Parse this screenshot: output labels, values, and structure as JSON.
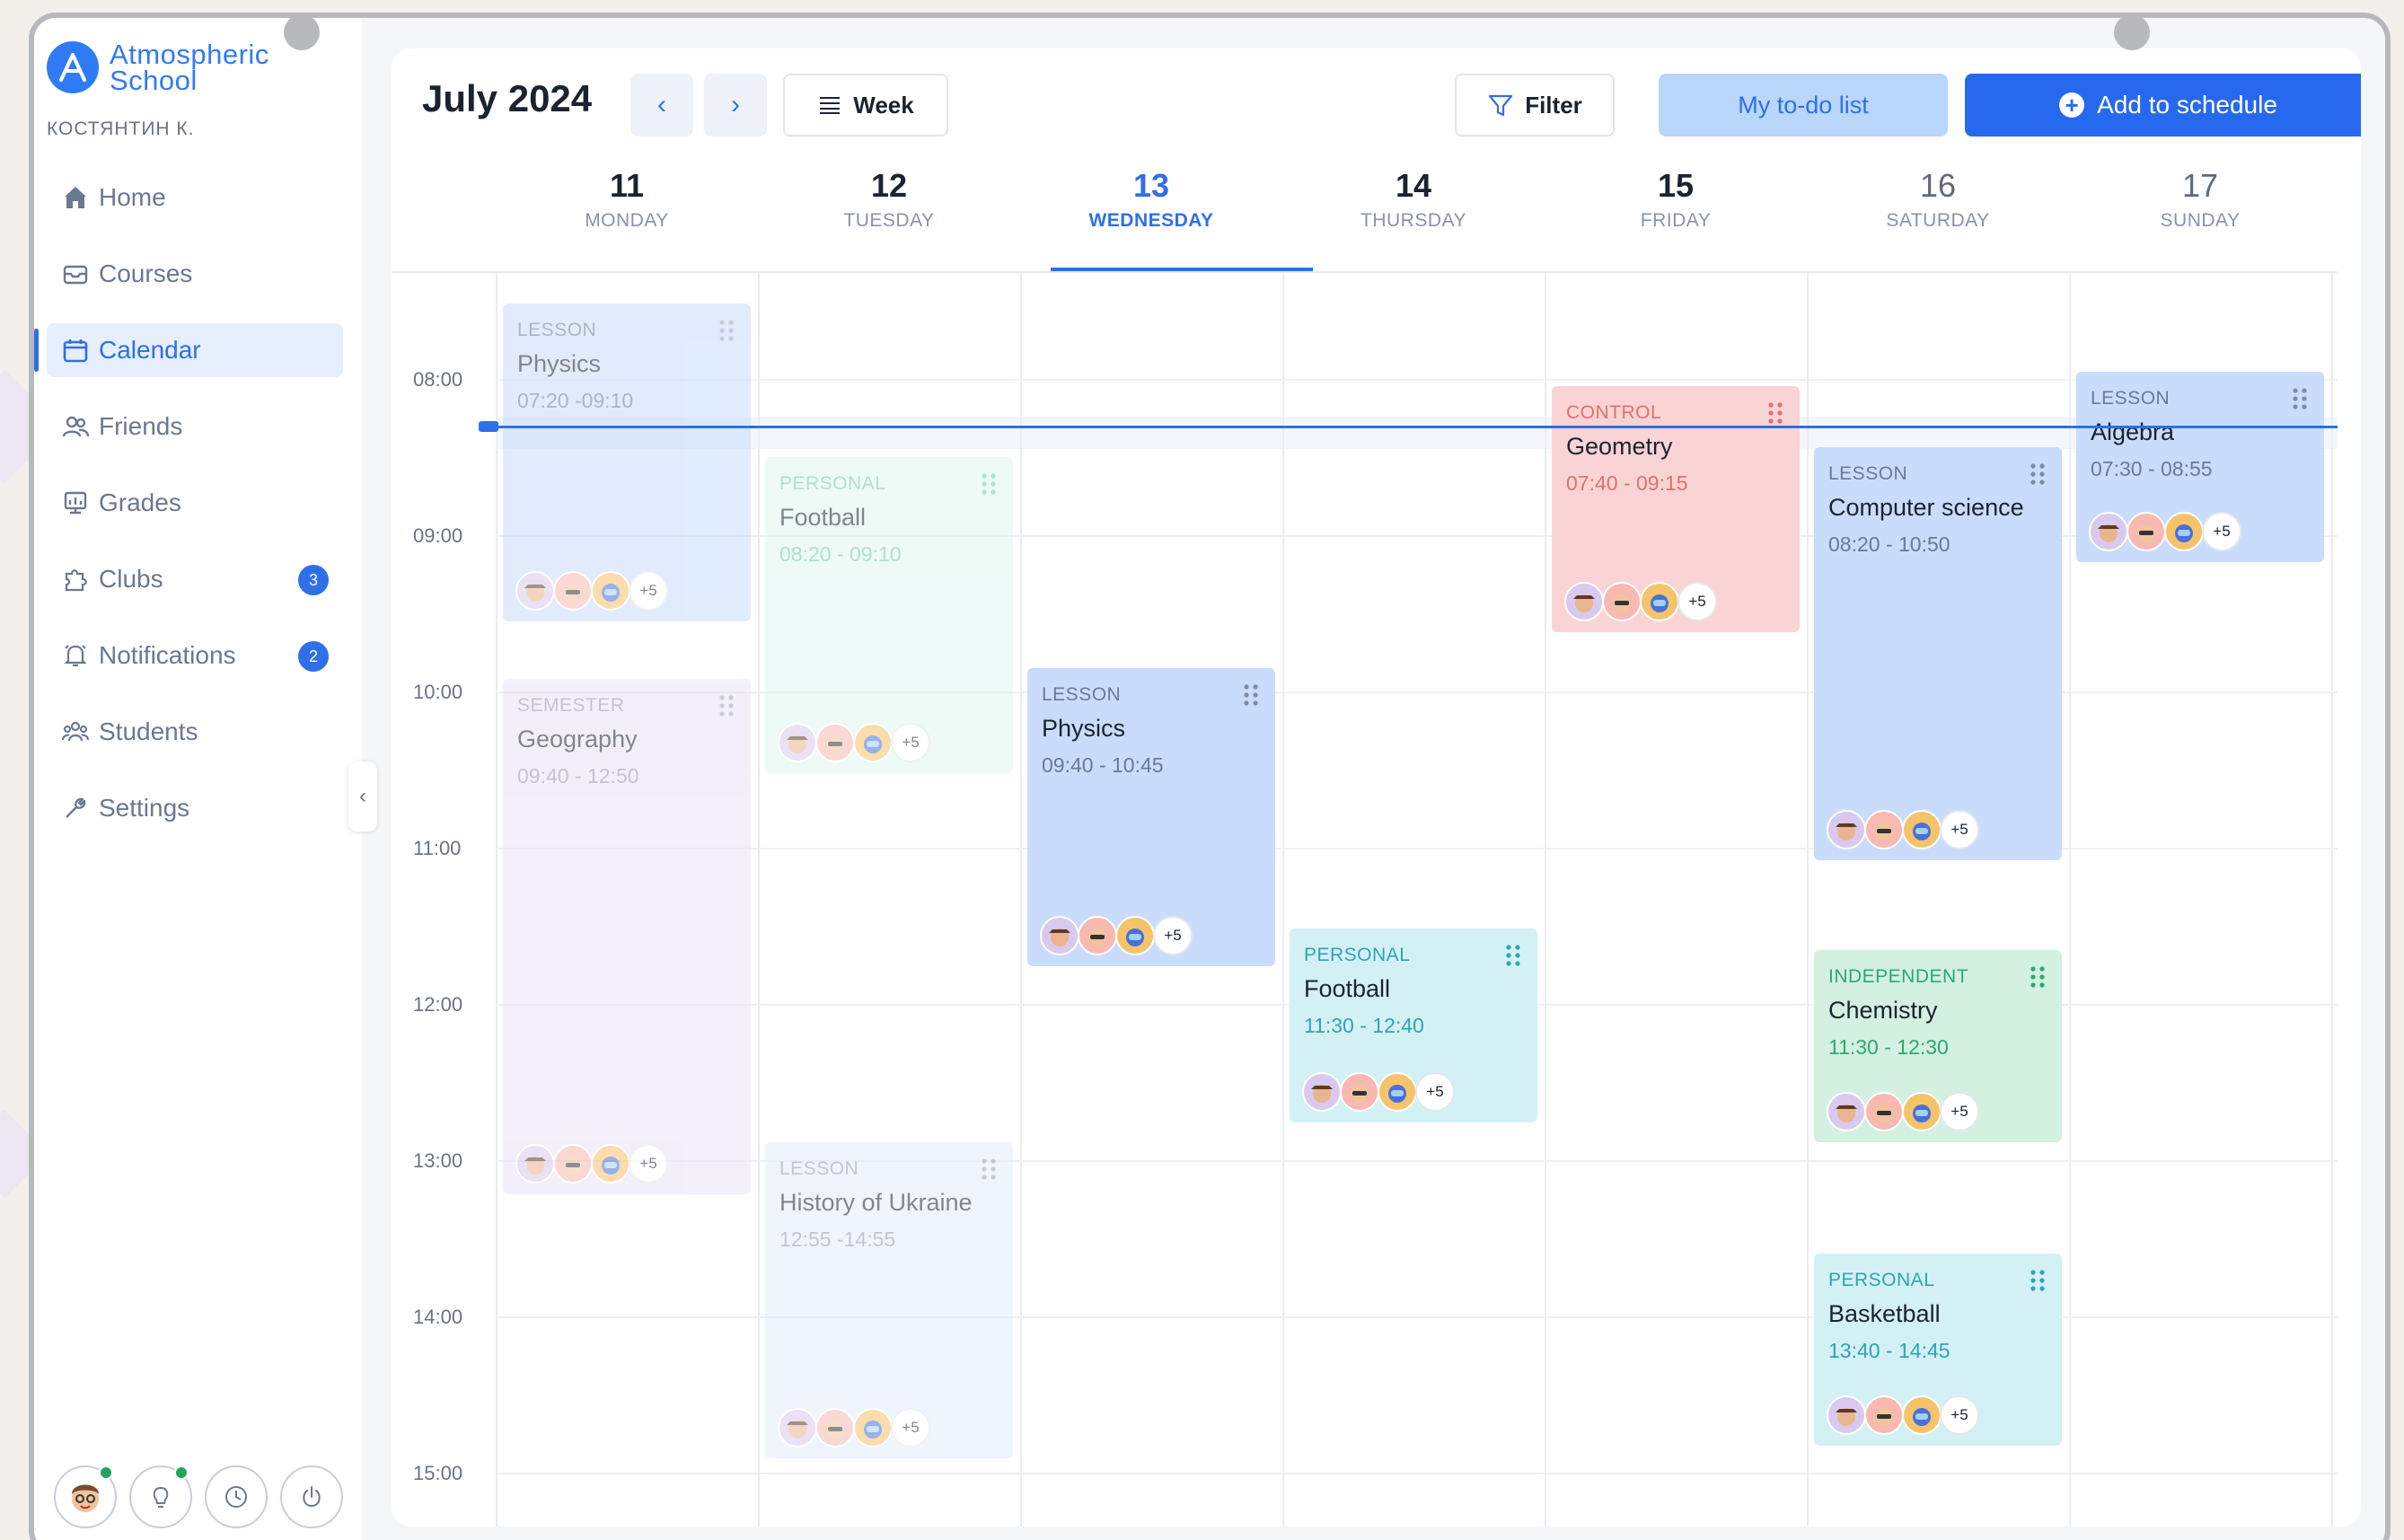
{
  "brand": {
    "line1": "Atmospheric",
    "line2": "School"
  },
  "user": {
    "name": "КОСТЯНТИН К."
  },
  "nav": [
    {
      "id": "home",
      "label": "Home",
      "icon": "home-icon"
    },
    {
      "id": "courses",
      "label": "Courses",
      "icon": "inbox-icon"
    },
    {
      "id": "calendar",
      "label": "Calendar",
      "icon": "calendar-icon",
      "active": true
    },
    {
      "id": "friends",
      "label": "Friends",
      "icon": "friends-icon"
    },
    {
      "id": "grades",
      "label": "Grades",
      "icon": "grades-icon"
    },
    {
      "id": "clubs",
      "label": "Clubs",
      "icon": "puzzle-icon",
      "badge": "3"
    },
    {
      "id": "notifications",
      "label": "Notifications",
      "icon": "bell-icon",
      "badge": "2"
    },
    {
      "id": "students",
      "label": "Students",
      "icon": "students-icon"
    },
    {
      "id": "settings",
      "label": "Settings",
      "icon": "wrench-icon"
    }
  ],
  "toolbar": {
    "month": "July 2024",
    "view": "Week",
    "filter": "Filter",
    "todo": "My to-do list",
    "add": "Add to schedule"
  },
  "days": [
    {
      "num": "11",
      "name": "MONDAY"
    },
    {
      "num": "12",
      "name": "TUESDAY"
    },
    {
      "num": "13",
      "name": "WEDNESDAY",
      "today": true
    },
    {
      "num": "14",
      "name": "THURSDAY"
    },
    {
      "num": "15",
      "name": "FRIDAY"
    },
    {
      "num": "16",
      "name": "SATURDAY"
    },
    {
      "num": "17",
      "name": "SUNDAY"
    }
  ],
  "times": [
    "08:00",
    "09:00",
    "10:00",
    "11:00",
    "12:00",
    "13:00",
    "14:00",
    "15:00"
  ],
  "events": [
    {
      "type": "LESSON",
      "title": "Physics",
      "time": "07:20 -09:10",
      "more": "+5",
      "color": "#c9dcfb"
    },
    {
      "type": "SEMESTER",
      "title": "Geography",
      "time": "09:40 - 12:50",
      "more": "+5",
      "color": "#ebe3f6"
    },
    {
      "type": "PERSONAL",
      "title": "Football",
      "time": "08:20 - 09:10",
      "more": "+5",
      "color": "#dff6f0"
    },
    {
      "type": "LESSON",
      "title": "History of Ukraine",
      "time": "12:55 -14:55",
      "more": "+5",
      "color": "#e4ecfb"
    },
    {
      "type": "LESSON",
      "title": "Physics",
      "time": "09:40 - 10:45",
      "more": "+5",
      "color": "#c9dcfb"
    },
    {
      "type": "PERSONAL",
      "title": "Football",
      "time": "11:30 - 12:40",
      "more": "+5",
      "color": "#d3f1f5"
    },
    {
      "type": "CONTROL",
      "title": "Geometry",
      "time": "07:40 - 09:15",
      "more": "+5",
      "color": "#fad4d4"
    },
    {
      "type": "LESSON",
      "title": "Computer science",
      "time": "08:20 - 10:50",
      "more": "+5",
      "color": "#c9dcfb"
    },
    {
      "type": "INDEPENDENT",
      "title": "Chemistry",
      "time": "11:30 - 12:30",
      "more": "+5",
      "color": "#d3f0e0"
    },
    {
      "type": "PERSONAL",
      "title": "Basketball",
      "time": "13:40 - 14:45",
      "more": "+5",
      "color": "#d3f1f5"
    },
    {
      "type": "LESSON",
      "title": "Algebra",
      "time": "07:30 - 08:55",
      "more": "+5",
      "color": "#c9dcfb"
    }
  ],
  "colors": {
    "accent": "#2f6fe8",
    "primary_button": "#2769ee"
  }
}
